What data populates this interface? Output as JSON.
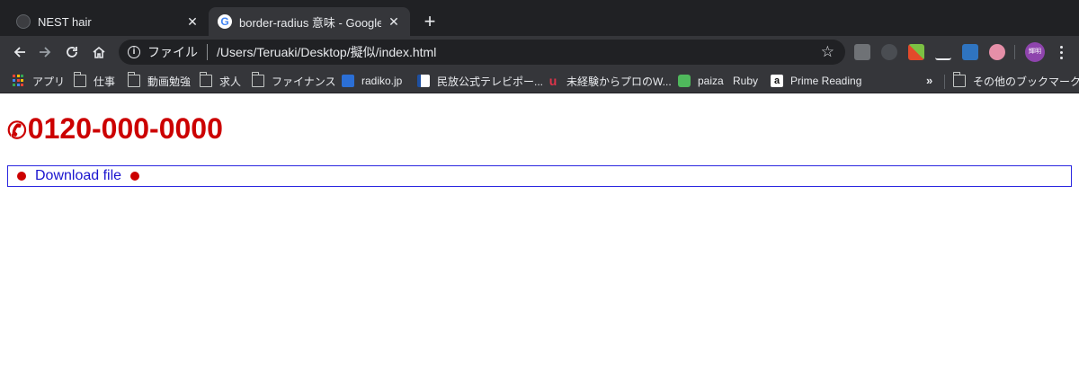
{
  "tabs": [
    {
      "title": "NEST hair",
      "close": "✕",
      "active": false
    },
    {
      "title": "border-radius 意味 - Google 検索",
      "close": "✕",
      "active": true
    }
  ],
  "new_tab": "+",
  "toolbar": {
    "scheme_label": "ファイル",
    "url": "/Users/Teruaki/Desktop/擬似/index.html",
    "profile_initials": "輝明"
  },
  "bookmarks": [
    {
      "label": "アプリ",
      "icon": "apps-grid-icon"
    },
    {
      "label": "仕事",
      "icon": "folder-icon"
    },
    {
      "label": "動画勉強",
      "icon": "folder-icon"
    },
    {
      "label": "求人",
      "icon": "folder-icon"
    },
    {
      "label": "ファイナンス",
      "icon": "folder-icon"
    },
    {
      "label": "radiko.jp",
      "icon": "radiko-icon"
    },
    {
      "label": "民放公式テレビポー...",
      "icon": "tver-icon"
    },
    {
      "label": "未経験からプロのW...",
      "icon": "u-icon"
    },
    {
      "label": "paiza",
      "icon": "paiza-icon"
    },
    {
      "label": "Ruby",
      "icon": "none"
    },
    {
      "label": "Prime Reading",
      "icon": "amazon-icon"
    }
  ],
  "bookmarks_more": "»",
  "other_bookmarks": "その他のブックマーク",
  "page": {
    "phone_icon": "✆",
    "phone_number": "0120-000-0000",
    "download_link": "Download file"
  },
  "colors": {
    "phone_red": "#cc0000",
    "link_blue": "#1a14cf",
    "box_border": "#2a26e0",
    "chrome_dark": "#202124",
    "chrome_toolbar": "#35363a"
  }
}
